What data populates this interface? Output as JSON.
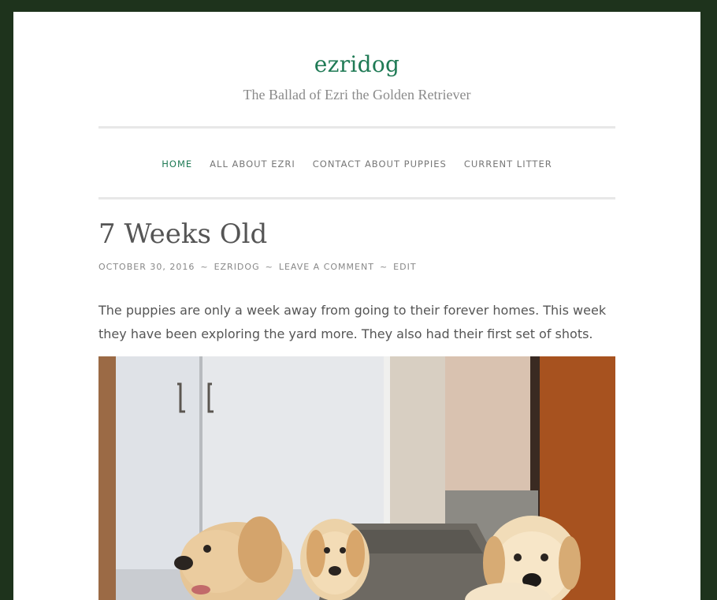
{
  "site": {
    "title": "ezridog",
    "description": "The Ballad of Ezri the Golden Retriever"
  },
  "nav": {
    "items": [
      {
        "label": "HOME",
        "active": true
      },
      {
        "label": "ALL ABOUT EZRI",
        "active": false
      },
      {
        "label": "CONTACT ABOUT PUPPIES",
        "active": false
      },
      {
        "label": "CURRENT LITTER",
        "active": false
      }
    ]
  },
  "post": {
    "title": "7 Weeks Old",
    "meta": {
      "date": "OCTOBER 30, 2016",
      "author": "EZRIDOG",
      "comment": "LEAVE A COMMENT",
      "edit": "EDIT",
      "separator": "~"
    },
    "body": "The puppies are only a week away from going to their forever homes. This week they have been exploring the yard more. They also had their first set of shots.",
    "image": {
      "icon": "puppies-photo"
    }
  },
  "colors": {
    "background": "#1e331c",
    "accent": "#1f7a55",
    "text": "#555555",
    "muted": "#888888"
  }
}
